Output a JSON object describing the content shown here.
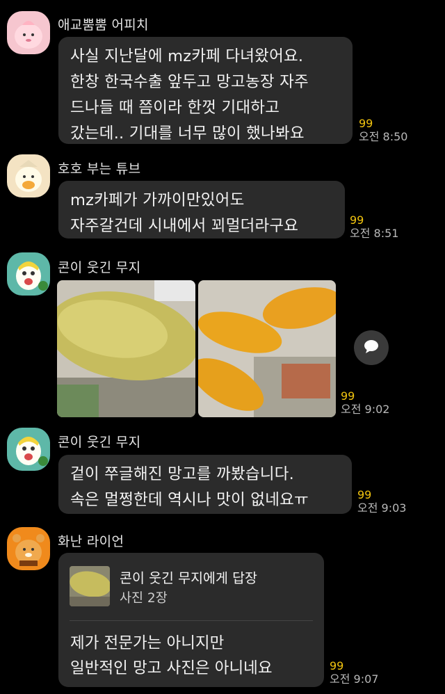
{
  "messages": [
    {
      "sender": "애교뿜뿜 어피치",
      "avatar_icon": "apeach-avatar-icon",
      "lines": [
        "사실 지난달에 mz카페 다녀왔어요.",
        "한창 한국수출 앞두고 망고농장 자주",
        "드나들 때 쯤이라 한껏 기대하고",
        "갔는데.. 기대를 너무 많이 했나봐요"
      ],
      "unread": "99",
      "time": "오전 8:50"
    },
    {
      "sender": "호호 부는 튜브",
      "avatar_icon": "tube-avatar-icon",
      "lines": [
        "mz카페가 가까이만있어도",
        "자주갈건데 시내에서 꾀멀더라구요"
      ],
      "unread": "99",
      "time": "오전 8:51"
    },
    {
      "sender": "콘이 웃긴 무지",
      "avatar_icon": "muzi-avatar-icon",
      "photos": [
        "whole-mango-photo",
        "sliced-mango-photo"
      ],
      "share_icon": "share-chat-icon",
      "unread": "99",
      "time": "오전 9:02"
    },
    {
      "sender": "콘이 웃긴 무지",
      "avatar_icon": "muzi-avatar-icon",
      "lines": [
        "겉이 쭈글해진 망고를 까봤습니다.",
        "속은 멀쩡한데 역시나 맛이 없네요ㅠ"
      ],
      "unread": "99",
      "time": "오전 9:03"
    },
    {
      "sender": "화난 라이언",
      "avatar_icon": "ryan-avatar-icon",
      "reply": {
        "title": "콘이 웃긴 무지에게 답장",
        "subtitle": "사진 2장"
      },
      "lines": [
        "제가 전문가는 아니지만",
        "일반적인 망고 사진은 아니네요"
      ],
      "unread": "99",
      "time": "오전 9:07"
    }
  ],
  "colors": {
    "background": "#000000",
    "bubble": "#2b2b2b",
    "unread_count": "#f2c40f",
    "timestamp": "#b9b9b9"
  }
}
